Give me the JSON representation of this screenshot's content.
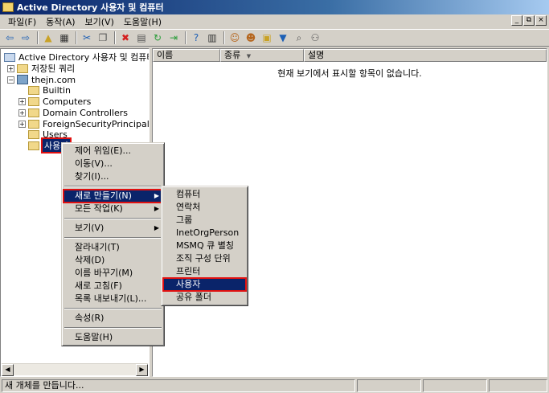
{
  "window": {
    "title": "Active Directory 사용자 및 컴퓨터"
  },
  "mdi_controls": [
    "_",
    "⧉",
    "×"
  ],
  "menubar": [
    {
      "label": "파일(F)"
    },
    {
      "label": "동작(A)"
    },
    {
      "label": "보기(V)"
    },
    {
      "label": "도움말(H)"
    }
  ],
  "toolbar": [
    {
      "icon": "back-arrow-icon",
      "glyph": "⇦",
      "color": "#1c5fb5"
    },
    {
      "icon": "forward-arrow-icon",
      "glyph": "⇨",
      "color": "#1c5fb5"
    },
    {
      "icon": "up-folder-icon",
      "glyph": "▲",
      "color": "#c9a227"
    },
    {
      "icon": "show-tree-icon",
      "glyph": "▦",
      "color": "#333333"
    },
    {
      "icon": "cut-icon",
      "glyph": "✂",
      "color": "#1c5fb5"
    },
    {
      "icon": "copy-icon",
      "glyph": "❐",
      "color": "#555555"
    },
    {
      "icon": "delete-icon",
      "glyph": "✖",
      "color": "#d42020"
    },
    {
      "icon": "properties-icon",
      "glyph": "▤",
      "color": "#555555"
    },
    {
      "icon": "refresh-icon",
      "glyph": "↻",
      "color": "#2a9d3a"
    },
    {
      "icon": "export-list-icon",
      "glyph": "⇥",
      "color": "#2a9d3a"
    },
    {
      "icon": "help-icon",
      "glyph": "?",
      "color": "#1c5fb5"
    },
    {
      "icon": "view-icon",
      "glyph": "▥",
      "color": "#333333"
    },
    {
      "icon": "new-user-icon",
      "glyph": "☺",
      "color": "#b5651d"
    },
    {
      "icon": "new-group-icon",
      "glyph": "☻",
      "color": "#b5651d"
    },
    {
      "icon": "new-ou-icon",
      "glyph": "▣",
      "color": "#c9a227"
    },
    {
      "icon": "filter-icon",
      "glyph": "▼",
      "color": "#1c5fb5"
    },
    {
      "icon": "find-icon",
      "glyph": "⌕",
      "color": "#555555"
    },
    {
      "icon": "add-to-group-icon",
      "glyph": "⚇",
      "color": "#555555"
    }
  ],
  "tree": [
    {
      "label": "Active Directory 사용자 및 컴퓨터",
      "expander": "",
      "icon": "snapin-icon"
    },
    {
      "label": "저장된 쿼리",
      "expander": "+",
      "icon": "folder-icon"
    },
    {
      "label": "thejn.com",
      "expander": "−",
      "icon": "domain-icon"
    },
    {
      "label": "Builtin",
      "expander": "",
      "icon": "folder-icon"
    },
    {
      "label": "Computers",
      "expander": "+",
      "icon": "folder-icon"
    },
    {
      "label": "Domain Controllers",
      "expander": "+",
      "icon": "folder-icon"
    },
    {
      "label": "ForeignSecurityPrincipals",
      "expander": "+",
      "icon": "folder-icon"
    },
    {
      "label": "Users",
      "expander": "",
      "icon": "folder-icon"
    },
    {
      "label": "사용자",
      "expander": "",
      "icon": "ou-icon"
    }
  ],
  "list": {
    "columns": [
      "이름",
      "종류",
      "설명"
    ],
    "sort_indicator": "▼",
    "empty_message": "현재 보기에서 표시할 항목이 없습니다."
  },
  "context_menu": {
    "groups": [
      [
        {
          "label": "제어 위임(E)..."
        },
        {
          "label": "이동(V)..."
        },
        {
          "label": "찾기(I)..."
        }
      ],
      [
        {
          "label": "새로 만들기(N)",
          "submenu": true,
          "highlight": true
        },
        {
          "label": "모든 작업(K)",
          "submenu": true
        }
      ],
      [
        {
          "label": "보기(V)",
          "submenu": true
        }
      ],
      [
        {
          "label": "잘라내기(T)"
        },
        {
          "label": "삭제(D)"
        },
        {
          "label": "이름 바꾸기(M)"
        },
        {
          "label": "새로 고침(F)"
        },
        {
          "label": "목록 내보내기(L)..."
        }
      ],
      [
        {
          "label": "속성(R)"
        }
      ],
      [
        {
          "label": "도움말(H)"
        }
      ]
    ]
  },
  "submenu": {
    "items": [
      {
        "label": "컴퓨터"
      },
      {
        "label": "연락처"
      },
      {
        "label": "그룹"
      },
      {
        "label": "InetOrgPerson"
      },
      {
        "label": "MSMQ 큐 별칭"
      },
      {
        "label": "조직 구성 단위"
      },
      {
        "label": "프린터"
      },
      {
        "label": "사용자",
        "highlight": true
      },
      {
        "label": "공유 폴더"
      }
    ]
  },
  "status": {
    "text": "새 개체를 만듭니다..."
  }
}
